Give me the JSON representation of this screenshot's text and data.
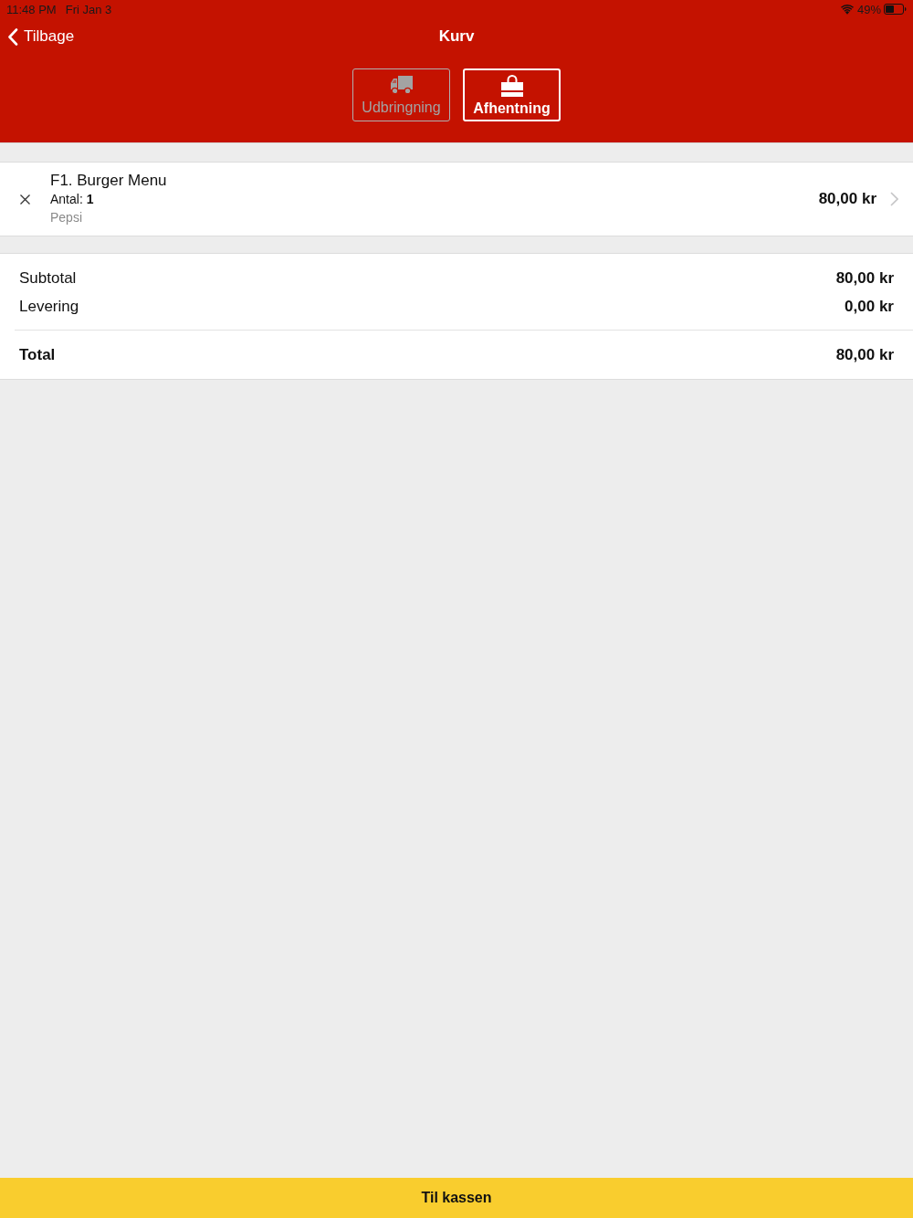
{
  "status_bar": {
    "time": "11:48 PM",
    "date": "Fri Jan 3",
    "battery_percent": "49%"
  },
  "nav": {
    "back": "Tilbage",
    "title": "Kurv"
  },
  "delivery_modes": [
    {
      "kind": "delivery",
      "label": "Udbringning",
      "selected": false
    },
    {
      "kind": "pickup",
      "label": "Afhentning",
      "selected": true
    }
  ],
  "cart_items": [
    {
      "name": "F1. Burger Menu",
      "quantity": "Antal: **1**",
      "option": "Pepsi",
      "price": "80,00 kr"
    }
  ],
  "summary": [
    {
      "label": "Subtotal",
      "value": "80,00 kr"
    },
    {
      "label": "Levering",
      "value": "0,00 kr"
    }
  ],
  "total": {
    "label": "Total",
    "value": "80,00 kr"
  },
  "checkout_button": "Til kassen"
}
